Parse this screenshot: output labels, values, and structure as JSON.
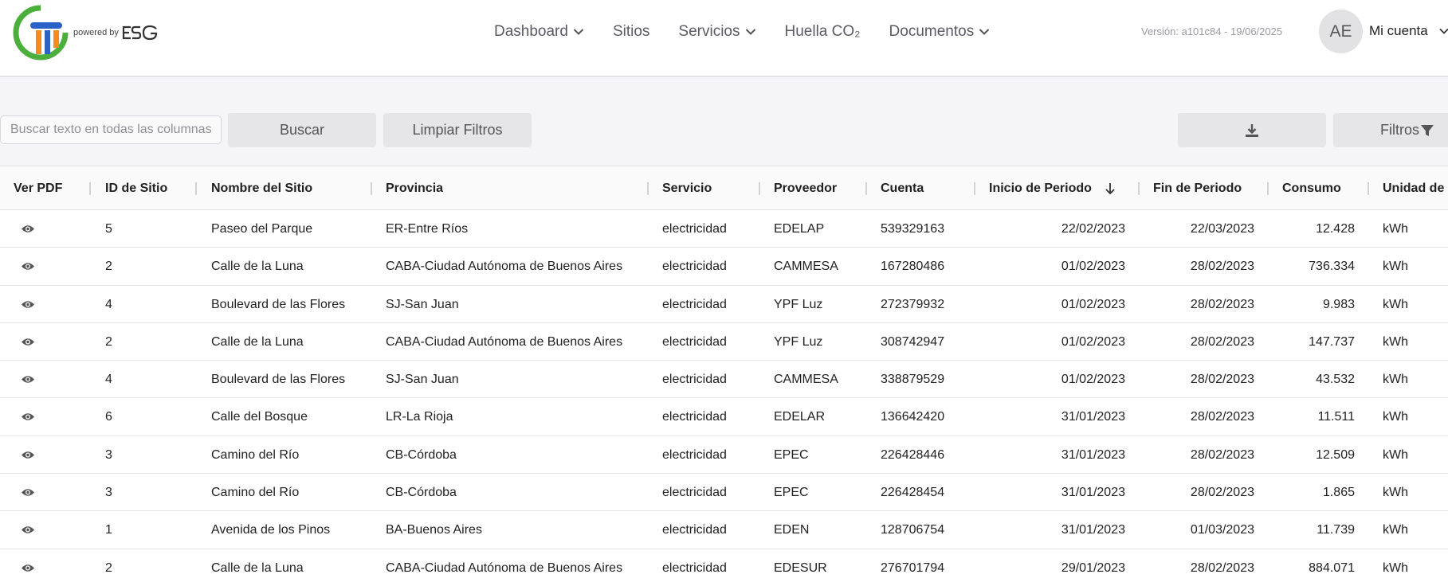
{
  "header": {
    "powered_by": "powered by",
    "nav": [
      {
        "label": "Dashboard",
        "dropdown": true
      },
      {
        "label": "Sitios",
        "dropdown": false
      },
      {
        "label": "Servicios",
        "dropdown": true
      },
      {
        "label": "Huella CO₂",
        "dropdown": false
      },
      {
        "label": "Documentos",
        "dropdown": true
      }
    ],
    "version": "Versión: a101c84 - 19/06/2025",
    "avatar_initials": "AE",
    "account_label": "Mi cuenta"
  },
  "toolbar": {
    "search_placeholder": "Buscar texto en todas las columnas",
    "search_value": "",
    "buscar_label": "Buscar",
    "limpiar_label": "Limpiar Filtros",
    "filtros_label": "Filtros"
  },
  "icons": {
    "download": "download-icon",
    "filter": "filter-icon",
    "view": "eye-icon",
    "sort": "arrow-down-icon",
    "chevron": "chevron-down-icon"
  },
  "colors": {
    "logo_green": "#4caf3c",
    "logo_blue": "#2b62c7",
    "logo_orange": "#f58a1f"
  },
  "table": {
    "columns": [
      "Ver PDF",
      "ID de Sitio",
      "Nombre del Sitio",
      "Provincia",
      "Servicio",
      "Proveedor",
      "Cuenta",
      "Inicio de Periodo",
      "Fin de Periodo",
      "Consumo",
      "Unidad de C"
    ],
    "sorted_column": "Inicio de Periodo",
    "sort_direction": "desc",
    "rows": [
      [
        "5",
        "Paseo del Parque",
        "ER-Entre Ríos",
        "electricidad",
        "EDELAP",
        "539329163",
        "22/02/2023",
        "22/03/2023",
        "12.428",
        "kWh"
      ],
      [
        "2",
        "Calle de la Luna",
        "CABA-Ciudad Autónoma de Buenos Aires",
        "electricidad",
        "CAMMESA",
        "167280486",
        "01/02/2023",
        "28/02/2023",
        "736.334",
        "kWh"
      ],
      [
        "4",
        "Boulevard de las Flores",
        "SJ-San Juan",
        "electricidad",
        "YPF Luz",
        "272379932",
        "01/02/2023",
        "28/02/2023",
        "9.983",
        "kWh"
      ],
      [
        "2",
        "Calle de la Luna",
        "CABA-Ciudad Autónoma de Buenos Aires",
        "electricidad",
        "YPF Luz",
        "308742947",
        "01/02/2023",
        "28/02/2023",
        "147.737",
        "kWh"
      ],
      [
        "4",
        "Boulevard de las Flores",
        "SJ-San Juan",
        "electricidad",
        "CAMMESA",
        "338879529",
        "01/02/2023",
        "28/02/2023",
        "43.532",
        "kWh"
      ],
      [
        "6",
        "Calle del Bosque",
        "LR-La Rioja",
        "electricidad",
        "EDELAR",
        "136642420",
        "31/01/2023",
        "28/02/2023",
        "11.511",
        "kWh"
      ],
      [
        "3",
        "Camino del Río",
        "CB-Córdoba",
        "electricidad",
        "EPEC",
        "226428446",
        "31/01/2023",
        "28/02/2023",
        "12.509",
        "kWh"
      ],
      [
        "3",
        "Camino del Río",
        "CB-Córdoba",
        "electricidad",
        "EPEC",
        "226428454",
        "31/01/2023",
        "28/02/2023",
        "1.865",
        "kWh"
      ],
      [
        "1",
        "Avenida de los Pinos",
        "BA-Buenos Aires",
        "electricidad",
        "EDEN",
        "128706754",
        "31/01/2023",
        "01/03/2023",
        "11.739",
        "kWh"
      ],
      [
        "2",
        "Calle de la Luna",
        "CABA-Ciudad Autónoma de Buenos Aires",
        "electricidad",
        "EDESUR",
        "276701794",
        "29/01/2023",
        "28/02/2023",
        "884.071",
        "kWh"
      ]
    ]
  }
}
